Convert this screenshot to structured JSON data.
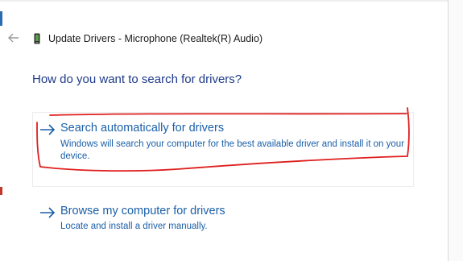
{
  "window": {
    "title": "Update Drivers - Microphone (Realtek(R) Audio)",
    "back_icon": "back-arrow-icon",
    "device_icon": "device-icon"
  },
  "page": {
    "heading": "How do you want to search for drivers?"
  },
  "options": [
    {
      "title": "Search automatically for drivers",
      "description": "Windows will search your computer for the best available driver and install it on your device.",
      "icon": "right-arrow-icon"
    },
    {
      "title": "Browse my computer for drivers",
      "description": "Locate and install a driver manually.",
      "icon": "right-arrow-icon"
    }
  ],
  "colors": {
    "link": "#1a5fa8",
    "heading": "#1e3a8a",
    "annotation": "#e01e1e"
  }
}
